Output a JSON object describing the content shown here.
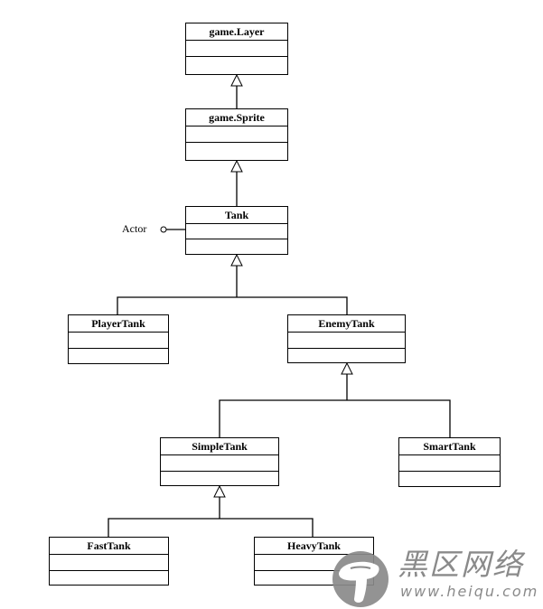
{
  "diagram": {
    "type": "uml-class-hierarchy",
    "classes": [
      {
        "id": "layer",
        "name": "game.Layer"
      },
      {
        "id": "sprite",
        "name": "game.Sprite"
      },
      {
        "id": "tank",
        "name": "Tank"
      },
      {
        "id": "player",
        "name": "PlayerTank"
      },
      {
        "id": "enemy",
        "name": "EnemyTank"
      },
      {
        "id": "simple",
        "name": "SimpleTank"
      },
      {
        "id": "smart",
        "name": "SmartTank"
      },
      {
        "id": "fast",
        "name": "FastTank"
      },
      {
        "id": "heavy",
        "name": "HeavyTank"
      }
    ],
    "interface": {
      "name": "Actor",
      "implemented_by": "tank"
    },
    "inheritance": [
      {
        "child": "sprite",
        "parent": "layer"
      },
      {
        "child": "tank",
        "parent": "sprite"
      },
      {
        "child": "player",
        "parent": "tank"
      },
      {
        "child": "enemy",
        "parent": "tank"
      },
      {
        "child": "simple",
        "parent": "enemy"
      },
      {
        "child": "smart",
        "parent": "enemy"
      },
      {
        "child": "fast",
        "parent": "simple"
      },
      {
        "child": "heavy",
        "parent": "simple"
      }
    ]
  },
  "watermark": {
    "title": "黑区网络",
    "url": "www.heiqu.com",
    "icon": "mushroom-logo-icon"
  },
  "colors": {
    "line": "#000000",
    "watermark": "#808080"
  }
}
